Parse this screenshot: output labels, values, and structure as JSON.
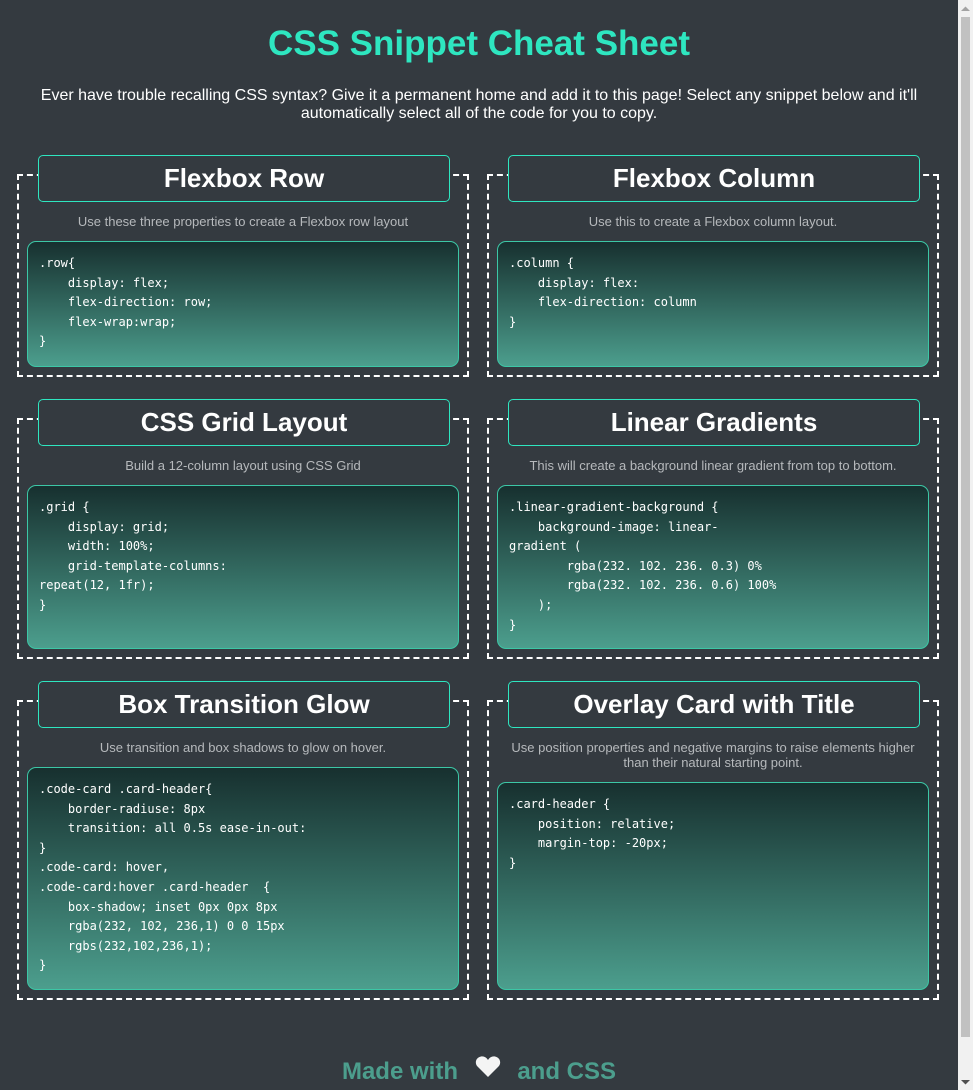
{
  "page": {
    "title": "CSS Snippet Cheat Sheet",
    "intro": "Ever have trouble recalling CSS syntax? Give it a permanent home and add it to this page! Select any snippet below and it'll automatically select all of the code for you to copy."
  },
  "cards": [
    {
      "title": "Flexbox Row",
      "description": "Use these three properties to create a Flexbox row layout",
      "code": ".row{\n    display: flex;\n    flex-direction: row;\n    flex-wrap:wrap;\n}"
    },
    {
      "title": "Flexbox Column",
      "description": "Use this to create a Flexbox column layout.",
      "code": ".column {\n    display: flex:\n    flex-direction: column\n}"
    },
    {
      "title": "CSS Grid Layout",
      "description": "Build a 12-column layout using CSS Grid",
      "code": ".grid {\n    display: grid;\n    width: 100%;\n    grid-template-columns:\nrepeat(12, 1fr);\n}"
    },
    {
      "title": "Linear Gradients",
      "description": "This will create a background linear gradient from top to bottom.",
      "code": ".linear-gradient-background {\n    background-image: linear-\ngradient (\n        rgba(232. 102. 236. 0.3) 0%\n        rgba(232. 102. 236. 0.6) 100%\n    );\n}"
    },
    {
      "title": "Box Transition Glow",
      "description": "Use transition and box shadows to glow on hover.",
      "code": ".code-card .card-header{\n    border-radiuse: 8px\n    transition: all 0.5s ease-in-out:\n}\n.code-card: hover,\n.code-card:hover .card-header  {\n    box-shadow; inset 0px 0px 8px\n    rgba(232, 102, 236,1) 0 0 15px\n    rgbs(232,102,236,1);\n}"
    },
    {
      "title": "Overlay Card with Title",
      "description": "Use position properties and negative margins to raise elements higher than their natural starting point.",
      "code": ".card-header {\n    position: relative;\n    margin-top: -20px;\n}"
    }
  ],
  "footer": {
    "before": "Made with",
    "icon": "heart-icon",
    "after": "and CSS"
  },
  "colors": {
    "background": "#343a40",
    "accent": "#2ee6c0",
    "footer": "#4c9e8d",
    "code_gradient_top": "#17302f",
    "code_gradient_bottom": "#4c9e8d"
  }
}
